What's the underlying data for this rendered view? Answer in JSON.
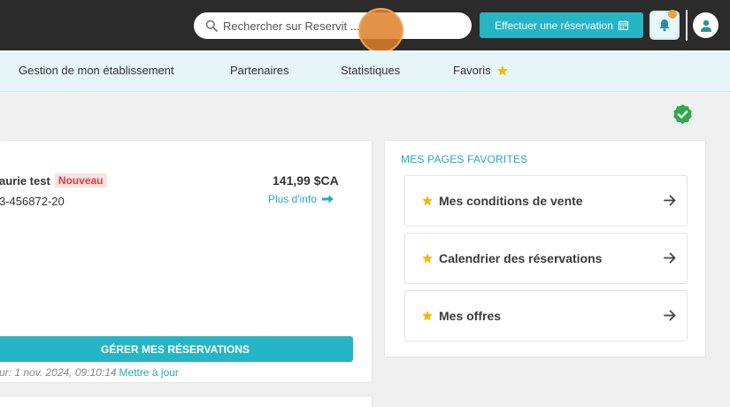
{
  "topbar": {
    "search_placeholder": "Rechercher sur Reservit ...",
    "reserve_button_label": "Effectuer une réservation"
  },
  "nav": {
    "items": [
      "Gestion de mon établissement",
      "Partenaires",
      "Statistiques",
      "Favoris"
    ]
  },
  "reservation": {
    "client_name": "aurie test",
    "badge": "Nouveau",
    "reference": "3-456872-20",
    "amount": "141,99 $CA",
    "more_info": "Plus d'info",
    "manage_button": "GÉRER MES RÉSERVATIONS",
    "updated_text": "ur: 1 nov. 2024, 09:10:14",
    "update_link": "Mettre à jour"
  },
  "favorites": {
    "title": "MES PAGES FAVORITES",
    "items": [
      "Mes conditions de vente",
      "Calendrier des réservations",
      "Mes offres"
    ]
  },
  "colors": {
    "accent": "#26b5c5",
    "topbar": "#2b2b2b",
    "nav_bg": "#e6f5f8",
    "star": "#f2b90c",
    "badge_text": "#e03c3c",
    "success": "#2eaa4a"
  }
}
